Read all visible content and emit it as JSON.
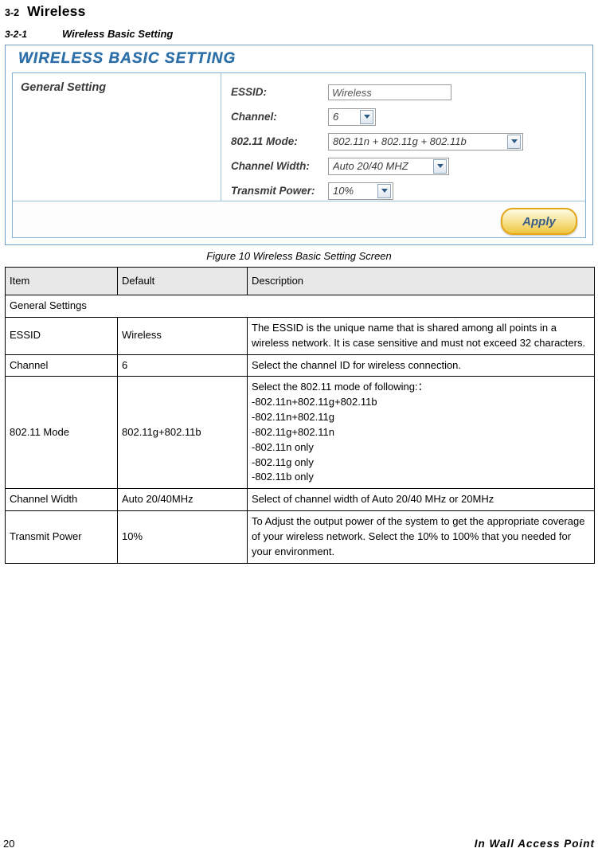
{
  "heading": {
    "section_number": "3-2",
    "section_title": "Wireless",
    "sub_number": "3-2-1",
    "sub_title": "Wireless Basic Setting"
  },
  "screenshot": {
    "panel_title": "WIRELESS BASIC SETTING",
    "group_label": "General Setting",
    "fields": [
      {
        "label": "ESSID:",
        "value": "Wireless",
        "type": "text"
      },
      {
        "label": "Channel:",
        "value": "6",
        "type": "select"
      },
      {
        "label": "802.11 Mode:",
        "value": "802.11n + 802.11g + 802.11b",
        "type": "select"
      },
      {
        "label": "Channel Width:",
        "value": "Auto 20/40 MHZ",
        "type": "select"
      },
      {
        "label": "Transmit Power:",
        "value": "10%",
        "type": "select"
      }
    ],
    "apply_label": "Apply"
  },
  "figure_caption": "Figure 10 Wireless Basic Setting Screen",
  "table": {
    "headers": [
      "Item",
      "Default",
      "Description"
    ],
    "group_row": "General Settings",
    "rows": [
      {
        "item": "ESSID",
        "default": "Wireless",
        "description": "The ESSID is the unique name that is shared among all points in a wireless network. It is case sensitive and must not exceed 32 characters."
      },
      {
        "item": "Channel",
        "default": "6",
        "description": "Select the channel ID for wireless connection."
      },
      {
        "item": "802.11 Mode",
        "default": "802.11g+802.11b",
        "description": "Select the 802.11 mode of following:：\n-802.11n+802.11g+802.11b\n-802.11n+802.11g\n-802.11g+802.11n\n-802.11n only\n-802.11g only\n-802.11b only"
      },
      {
        "item": "Channel Width",
        "default": "Auto 20/40MHz",
        "description": "Select of channel width of Auto 20/40 MHz or 20MHz"
      },
      {
        "item": "Transmit Power",
        "default": "10%",
        "description": "To Adjust the output power of the system to get the appropriate coverage of your wireless network. Select the 10% to 100% that you needed for your environment."
      }
    ]
  },
  "footer": {
    "page_number": "20",
    "document_name": "In Wall Access Point"
  }
}
